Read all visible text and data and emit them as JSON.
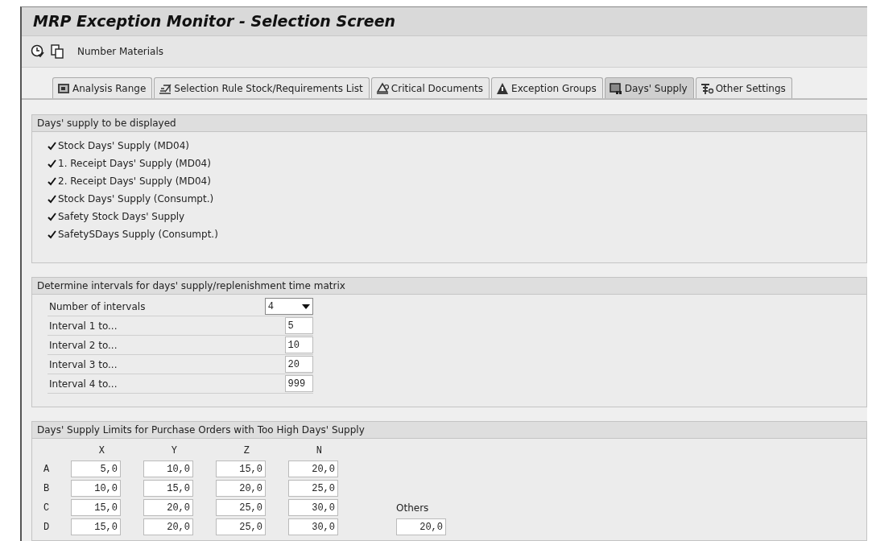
{
  "window": {
    "title": "MRP Exception Monitor - Selection Screen"
  },
  "toolbar": {
    "buttons": [
      {
        "kind": "clock"
      },
      {
        "kind": "copy"
      }
    ],
    "label": "Number Materials"
  },
  "tabs": [
    {
      "label": "Analysis Range",
      "kind": "range",
      "selected": false
    },
    {
      "label": "Selection Rule Stock/Requirements List",
      "kind": "rule",
      "selected": false
    },
    {
      "label": "Critical Documents",
      "kind": "critical",
      "selected": false
    },
    {
      "label": "Exception Groups",
      "kind": "warning",
      "selected": false
    },
    {
      "label": "Days' Supply",
      "kind": "monitor",
      "selected": true
    },
    {
      "label": "Other Settings",
      "kind": "settings",
      "selected": false
    }
  ],
  "days_supply_group": {
    "title": "Days' supply to be displayed",
    "items": [
      {
        "label": "Stock Days' Supply (MD04)",
        "checked": true
      },
      {
        "label": "1. Receipt Days' Supply (MD04)",
        "checked": true
      },
      {
        "label": "2. Receipt Days' Supply (MD04)",
        "checked": true
      },
      {
        "label": "Stock Days' Supply (Consumpt.)",
        "checked": true
      },
      {
        "label": "Safety Stock Days' Supply",
        "checked": true
      },
      {
        "label": "SafetySDays Supply (Consumpt.)",
        "checked": true
      }
    ]
  },
  "intervals_group": {
    "title": "Determine intervals for days' supply/replenishment time matrix",
    "rows": [
      {
        "label": "Number of intervals",
        "kind": "dropdown",
        "value": "4"
      },
      {
        "label": "Interval 1 to...",
        "kind": "input",
        "value": "5"
      },
      {
        "label": "Interval 2 to...",
        "kind": "input",
        "value": "10"
      },
      {
        "label": "Interval 3 to...",
        "kind": "input",
        "value": "20"
      },
      {
        "label": "Interval 4 to...",
        "kind": "input",
        "value": "999"
      }
    ]
  },
  "limits_group": {
    "title": "Days' Supply Limits for Purchase Orders with Too High Days' Supply",
    "columns": [
      "X",
      "Y",
      "Z",
      "N"
    ],
    "rows": [
      {
        "label": "A",
        "values": [
          "5,0",
          "10,0",
          "15,0",
          "20,0"
        ]
      },
      {
        "label": "B",
        "values": [
          "10,0",
          "15,0",
          "20,0",
          "25,0"
        ]
      },
      {
        "label": "C",
        "values": [
          "15,0",
          "20,0",
          "25,0",
          "30,0"
        ]
      },
      {
        "label": "D",
        "values": [
          "15,0",
          "20,0",
          "25,0",
          "30,0"
        ]
      }
    ],
    "others": {
      "label": "Others",
      "value": "20,0"
    }
  }
}
